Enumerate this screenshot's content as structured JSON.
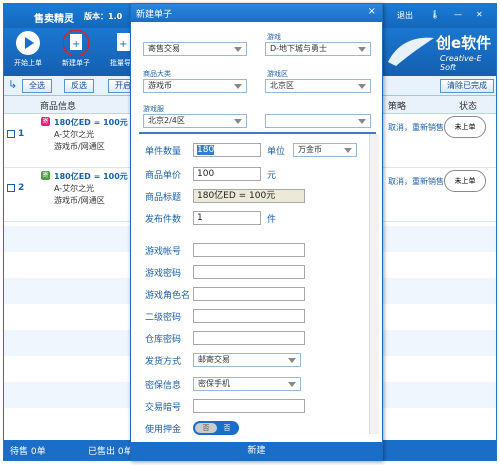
{
  "app": {
    "title": "售卖精灵",
    "version": "版本：1.0",
    "logout": "退出",
    "toolbar": {
      "start": "开始上单",
      "new": "新建单子",
      "import": "批量导入"
    },
    "logo": {
      "big": "创e软件",
      "small": "Creative-E Soft"
    },
    "actions": {
      "select_all": "全选",
      "invert": "反选",
      "open": "开启",
      "clear": "清除已完成"
    },
    "columns": {
      "info": "商品信息",
      "strategy": "策略",
      "status": "状态"
    },
    "rows": [
      {
        "num": "1",
        "tag": "寄",
        "line1": "180亿ED = 100元",
        "line2": "A-艾尔之光",
        "line3": "游戏币/网通区",
        "right": "取消，重新销售",
        "status": "未上单"
      },
      {
        "num": "2",
        "tag": "寄",
        "line1": "180亿ED = 100元",
        "line2": "A-艾尔之光",
        "line3": "游戏币/网通区",
        "right": "取消，重新销售",
        "status": "未上单"
      }
    ],
    "status": {
      "pending": "待售  0单",
      "sold": "已售出  0单"
    }
  },
  "dialog": {
    "title": "新建单子",
    "close": "×",
    "labels": {
      "game": "游戏",
      "category": "商品大类",
      "zone": "游戏区",
      "server": "游戏服"
    },
    "selects": {
      "trade": "寄售交易",
      "game": "D-地下城与勇士",
      "category": "游戏币",
      "zone": "北京区",
      "server": "北京2/4区",
      "server2": ""
    },
    "fields": {
      "qty_label": "单件数量",
      "qty_value": "180",
      "unit_label": "单位",
      "unit_value": "万金币",
      "price_label": "商品单价",
      "price_value": "100",
      "price_unit": "元",
      "title_label": "商品标题",
      "title_value": "180亿ED = 100元",
      "count_label": "发布件数",
      "count_value": "1",
      "count_unit": "件",
      "account_label": "游戏帐号",
      "password_label": "游戏密码",
      "role_label": "游戏角色名",
      "pwd2_label": "二级密码",
      "warehouse_label": "仓库密码",
      "ship_label": "发货方式",
      "ship_value": "邮寄交易",
      "protect_label": "密保信息",
      "protect_value": "密保手机",
      "code_label": "交易暗号",
      "deposit_label": "使用押金",
      "toggle_off": "否",
      "toggle_on": "否"
    },
    "submit": "新建"
  },
  "colors": {
    "primary": "#1b6ec8",
    "accent": "#d8e7f6"
  }
}
